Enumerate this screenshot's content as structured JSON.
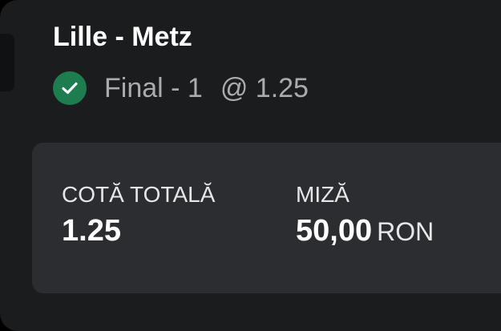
{
  "bet": {
    "match": "Lille - Metz",
    "selection": "Final - 1",
    "selection_odds": "@ 1.25",
    "status_icon": "check-circle-icon"
  },
  "summary": {
    "total_odds_label": "COTĂ TOTALĂ",
    "total_odds_value": "1.25",
    "stake_label": "MIZĂ",
    "stake_value": "50,00",
    "stake_currency": "RON"
  },
  "colors": {
    "card_background": "#1b1c1e",
    "summary_background": "#2b2d30",
    "success_green": "#1e7d4f",
    "muted_text": "#a9abae"
  }
}
